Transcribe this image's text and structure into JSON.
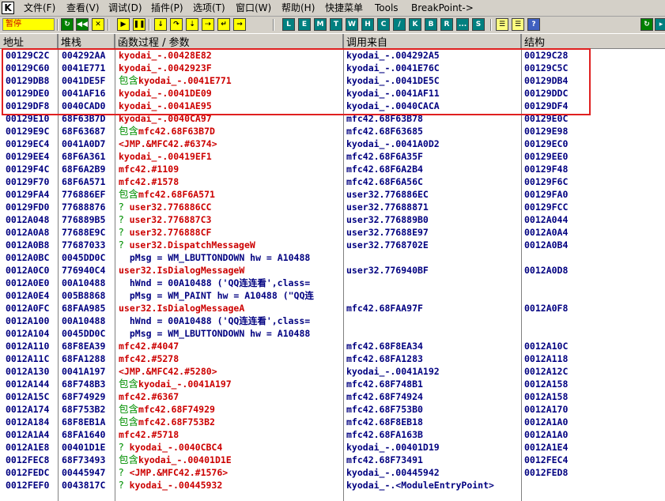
{
  "menubar": {
    "app_icon": "K",
    "items": [
      "文件(F)",
      "查看(V)",
      "调试(D)",
      "插件(P)",
      "选项(T)",
      "窗口(W)",
      "帮助(H)",
      "快捷菜单",
      "Tools",
      "BreakPoint->"
    ]
  },
  "toolbar": {
    "status": "暂停",
    "letters": [
      "L",
      "E",
      "M",
      "T",
      "W",
      "H",
      "C",
      "/",
      "K",
      "B",
      "R",
      "...",
      "S"
    ]
  },
  "table": {
    "columns": [
      "地址",
      "堆栈",
      "函数过程 / 参数",
      "调用来自",
      "结构"
    ],
    "rows": [
      {
        "addr": "00129C2C",
        "stack": "004292AA",
        "pre": "",
        "proc": "kyodai_-.00428E82",
        "pk": "r",
        "from": "kyodai_-.004292A5",
        "fk": "n",
        "frame": "00129C28"
      },
      {
        "addr": "00129C60",
        "stack": "0041E771",
        "pre": "",
        "proc": "kyodai_-.0042923F",
        "pk": "r",
        "from": "kyodai_-.0041E76C",
        "fk": "n",
        "frame": "00129C5C"
      },
      {
        "addr": "00129DB8",
        "stack": "0041DE5F",
        "pre": "包含",
        "proc": "kyodai_-.0041E771",
        "pk": "r",
        "from": "kyodai_-.0041DE5C",
        "fk": "n",
        "frame": "00129DB4"
      },
      {
        "addr": "00129DE0",
        "stack": "0041AF16",
        "pre": "",
        "proc": "kyodai_-.0041DE09",
        "pk": "r",
        "from": "kyodai_-.0041AF11",
        "fk": "n",
        "frame": "00129DDC"
      },
      {
        "addr": "00129DF8",
        "stack": "0040CAD0",
        "pre": "",
        "proc": "kyodai_-.0041AE95",
        "pk": "r",
        "from": "kyodai_-.0040CACA",
        "fk": "n",
        "frame": "00129DF4"
      },
      {
        "addr": "00129E10",
        "stack": "68F63B7D",
        "pre": "",
        "proc": "kyodai_-.0040CA97",
        "pk": "r",
        "from": "mfc42.68F63B78",
        "fk": "n",
        "frame": "00129E0C"
      },
      {
        "addr": "00129E9C",
        "stack": "68F63687",
        "pre": "包含",
        "proc": "mfc42.68F63B7D",
        "pk": "r",
        "from": "mfc42.68F63685",
        "fk": "n",
        "frame": "00129E98"
      },
      {
        "addr": "00129EC4",
        "stack": "0041A0D7",
        "pre": "",
        "proc": "<JMP.&MFC42.#6374>",
        "pk": "r",
        "from": "kyodai_-.0041A0D2",
        "fk": "n",
        "frame": "00129EC0"
      },
      {
        "addr": "00129EE4",
        "stack": "68F6A361",
        "pre": "",
        "proc": "kyodai_-.00419EF1",
        "pk": "r",
        "from": "mfc42.68F6A35F",
        "fk": "n",
        "frame": "00129EE0"
      },
      {
        "addr": "00129F4C",
        "stack": "68F6A2B9",
        "pre": "",
        "proc": "mfc42.#1109",
        "pk": "r",
        "from": "mfc42.68F6A2B4",
        "fk": "n",
        "frame": "00129F48"
      },
      {
        "addr": "00129F70",
        "stack": "68F6A571",
        "pre": "",
        "proc": "mfc42.#1578",
        "pk": "r",
        "from": "mfc42.68F6A56C",
        "fk": "n",
        "frame": "00129F6C"
      },
      {
        "addr": "00129FA4",
        "stack": "776886EF",
        "pre": "包含",
        "proc": "mfc42.68F6A571",
        "pk": "r",
        "from": "user32.776886EC",
        "fk": "n",
        "frame": "00129FA0"
      },
      {
        "addr": "00129FD0",
        "stack": "77688876",
        "pre": "?",
        "proc": "user32.776886CC",
        "pk": "r",
        "from": "user32.77688871",
        "fk": "n",
        "frame": "00129FCC"
      },
      {
        "addr": "0012A048",
        "stack": "776889B5",
        "pre": "?",
        "proc": "user32.776887C3",
        "pk": "r",
        "from": "user32.776889B0",
        "fk": "n",
        "frame": "0012A044"
      },
      {
        "addr": "0012A0A8",
        "stack": "77688E9C",
        "pre": "?",
        "proc": "user32.776888CF",
        "pk": "r",
        "from": "user32.77688E97",
        "fk": "n",
        "frame": "0012A0A4"
      },
      {
        "addr": "0012A0B8",
        "stack": "77687033",
        "pre": "?",
        "proc": "user32.DispatchMessageW",
        "pk": "r",
        "from": "user32.7768702E",
        "fk": "n",
        "frame": "0012A0B4"
      },
      {
        "addr": "0012A0BC",
        "stack": "0045DD0C",
        "pre": "",
        "proc": "  pMsg = WM_LBUTTONDOWN hw = A10488",
        "pk": "n",
        "from": "",
        "fk": "n",
        "frame": ""
      },
      {
        "addr": "0012A0C0",
        "stack": "776940C4",
        "pre": "",
        "proc": "user32.IsDialogMessageW",
        "pk": "r",
        "from": "user32.776940BF",
        "fk": "n",
        "frame": "0012A0D8"
      },
      {
        "addr": "0012A0E0",
        "stack": "00A10488",
        "pre": "",
        "proc": "  hWnd = 00A10488 ('QQ连连看',class=",
        "pk": "n",
        "from": "",
        "fk": "n",
        "frame": ""
      },
      {
        "addr": "0012A0E4",
        "stack": "005B8868",
        "pre": "",
        "proc": "  pMsg = WM_PAINT hw = A10488 (\"QQ连",
        "pk": "n",
        "from": "",
        "fk": "n",
        "frame": ""
      },
      {
        "addr": "0012A0FC",
        "stack": "68FAA985",
        "pre": "",
        "proc": "user32.IsDialogMessageA",
        "pk": "r",
        "from": "mfc42.68FAA97F",
        "fk": "n",
        "frame": "0012A0F8"
      },
      {
        "addr": "0012A100",
        "stack": "00A10488",
        "pre": "",
        "proc": "  hWnd = 00A10488 ('QQ连连看',class=",
        "pk": "n",
        "from": "",
        "fk": "n",
        "frame": ""
      },
      {
        "addr": "0012A104",
        "stack": "0045DD0C",
        "pre": "",
        "proc": "  pMsg = WM_LBUTTONDOWN hw = A10488",
        "pk": "n",
        "from": "",
        "fk": "n",
        "frame": ""
      },
      {
        "addr": "0012A110",
        "stack": "68F8EA39",
        "pre": "",
        "proc": "mfc42.#4047",
        "pk": "r",
        "from": "mfc42.68F8EA34",
        "fk": "n",
        "frame": "0012A10C"
      },
      {
        "addr": "0012A11C",
        "stack": "68FA1288",
        "pre": "",
        "proc": "mfc42.#5278",
        "pk": "r",
        "from": "mfc42.68FA1283",
        "fk": "n",
        "frame": "0012A118"
      },
      {
        "addr": "0012A130",
        "stack": "0041A197",
        "pre": "",
        "proc": "<JMP.&MFC42.#5280>",
        "pk": "r",
        "from": "kyodai_-.0041A192",
        "fk": "n",
        "frame": "0012A12C"
      },
      {
        "addr": "0012A144",
        "stack": "68F748B3",
        "pre": "包含",
        "proc": "kyodai_-.0041A197",
        "pk": "r",
        "from": "mfc42.68F748B1",
        "fk": "n",
        "frame": "0012A158"
      },
      {
        "addr": "0012A15C",
        "stack": "68F74929",
        "pre": "",
        "proc": "mfc42.#6367",
        "pk": "r",
        "from": "mfc42.68F74924",
        "fk": "n",
        "frame": "0012A158"
      },
      {
        "addr": "0012A174",
        "stack": "68F753B2",
        "pre": "包含",
        "proc": "mfc42.68F74929",
        "pk": "r",
        "from": "mfc42.68F753B0",
        "fk": "n",
        "frame": "0012A170"
      },
      {
        "addr": "0012A184",
        "stack": "68F8EB1A",
        "pre": "包含",
        "proc": "mfc42.68F753B2",
        "pk": "r",
        "from": "mfc42.68F8EB18",
        "fk": "n",
        "frame": "0012A1A0"
      },
      {
        "addr": "0012A1A4",
        "stack": "68FA1640",
        "pre": "",
        "proc": "mfc42.#5718",
        "pk": "r",
        "from": "mfc42.68FA163B",
        "fk": "n",
        "frame": "0012A1A0"
      },
      {
        "addr": "0012A1E8",
        "stack": "00401D1E",
        "pre": "?",
        "proc": "kyodai_-.0040CBC4",
        "pk": "r",
        "from": "kyodai_-.00401D19",
        "fk": "n",
        "frame": "0012A1E4"
      },
      {
        "addr": "0012FEC8",
        "stack": "68F73493",
        "pre": "包含",
        "proc": "kyodai_-.00401D1E",
        "pk": "r",
        "from": "mfc42.68F73491",
        "fk": "n",
        "frame": "0012FEC4"
      },
      {
        "addr": "0012FEDC",
        "stack": "00445947",
        "pre": "?",
        "proc": "<JMP.&MFC42.#1576>",
        "pk": "r",
        "from": "kyodai_-.00445942",
        "fk": "n",
        "frame": "0012FED8"
      },
      {
        "addr": "0012FEF0",
        "stack": "0043817C",
        "pre": "?",
        "proc": "kyodai_-.00445932",
        "pk": "r",
        "from": "kyodai_-.<ModuleEntryPoint>",
        "fk": "n",
        "frame": ""
      }
    ]
  },
  "highlight": {
    "color": "#e02020",
    "first_row": 0,
    "last_row": 4
  },
  "colors": {
    "text_red": "#cc0000",
    "text_navy": "#000080",
    "prefix_green": "#009000",
    "toolbar_bg": "#d4d0c8"
  }
}
